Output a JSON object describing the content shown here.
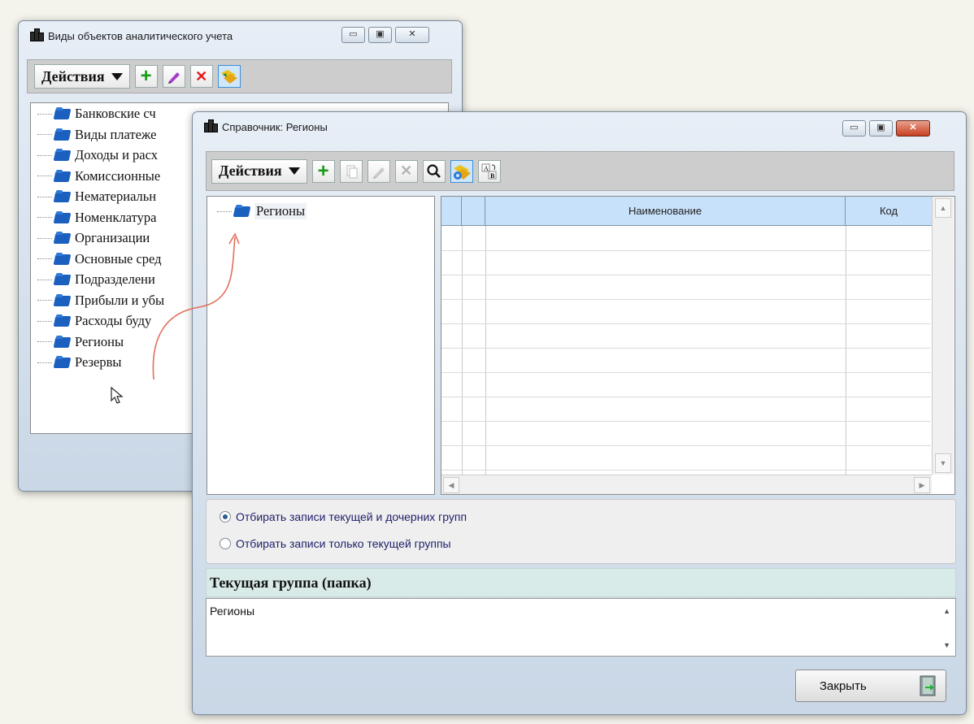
{
  "back_window": {
    "title": "Виды объектов аналитического учета",
    "actions_label": "Действия",
    "tree_items": [
      "Банковские сч",
      "Виды платеже",
      "Доходы и расх",
      "Комиссионные",
      "Нематериальн",
      "Номенклатура",
      "Организации",
      "Основные сред",
      "Подразделени",
      "Прибыли и убы",
      "Расходы буду",
      "Регионы",
      "Резервы"
    ]
  },
  "front_window": {
    "title": "Справочник: Регионы",
    "actions_label": "Действия",
    "tree_root": "Регионы",
    "grid_headers": {
      "name": "Наименование",
      "code": "Код"
    },
    "filter_options": [
      {
        "label": "Отбирать записи текущей и дочерних групп",
        "checked": true
      },
      {
        "label": "Отбирать записи только текущей группы",
        "checked": false
      }
    ],
    "current_group_header": "Текущая группа (папка)",
    "current_group_value": "Регионы",
    "close_label": "Закрыть"
  }
}
